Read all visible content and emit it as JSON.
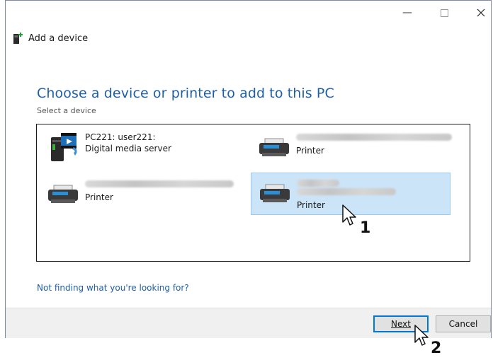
{
  "window": {
    "title": "Add a device",
    "controls": [
      "minimize-icon",
      "maximize-icon",
      "close-icon"
    ]
  },
  "main": {
    "heading": "Choose a device or printer to add to this PC",
    "subheading": "Select a device",
    "devices": [
      {
        "name": "PC221: user221:",
        "type": "Digital media server",
        "icon": "media-server-icon",
        "selected": false
      },
      {
        "name": "",
        "type": "Printer",
        "icon": "printer-icon",
        "selected": false
      },
      {
        "name": "",
        "type": "Printer",
        "icon": "printer-icon",
        "selected": false
      },
      {
        "name": "",
        "type": "Printer",
        "icon": "printer-icon",
        "selected": true
      }
    ],
    "help_link": "Not finding what you're looking for?"
  },
  "footer": {
    "next_label": "Next",
    "cancel_label": "Cancel"
  },
  "callouts": {
    "step1": "1",
    "step2": "2"
  },
  "colors": {
    "accent": "#1f5fa6",
    "selection": "#cce4f7",
    "default_button_border": "#0078d7"
  }
}
